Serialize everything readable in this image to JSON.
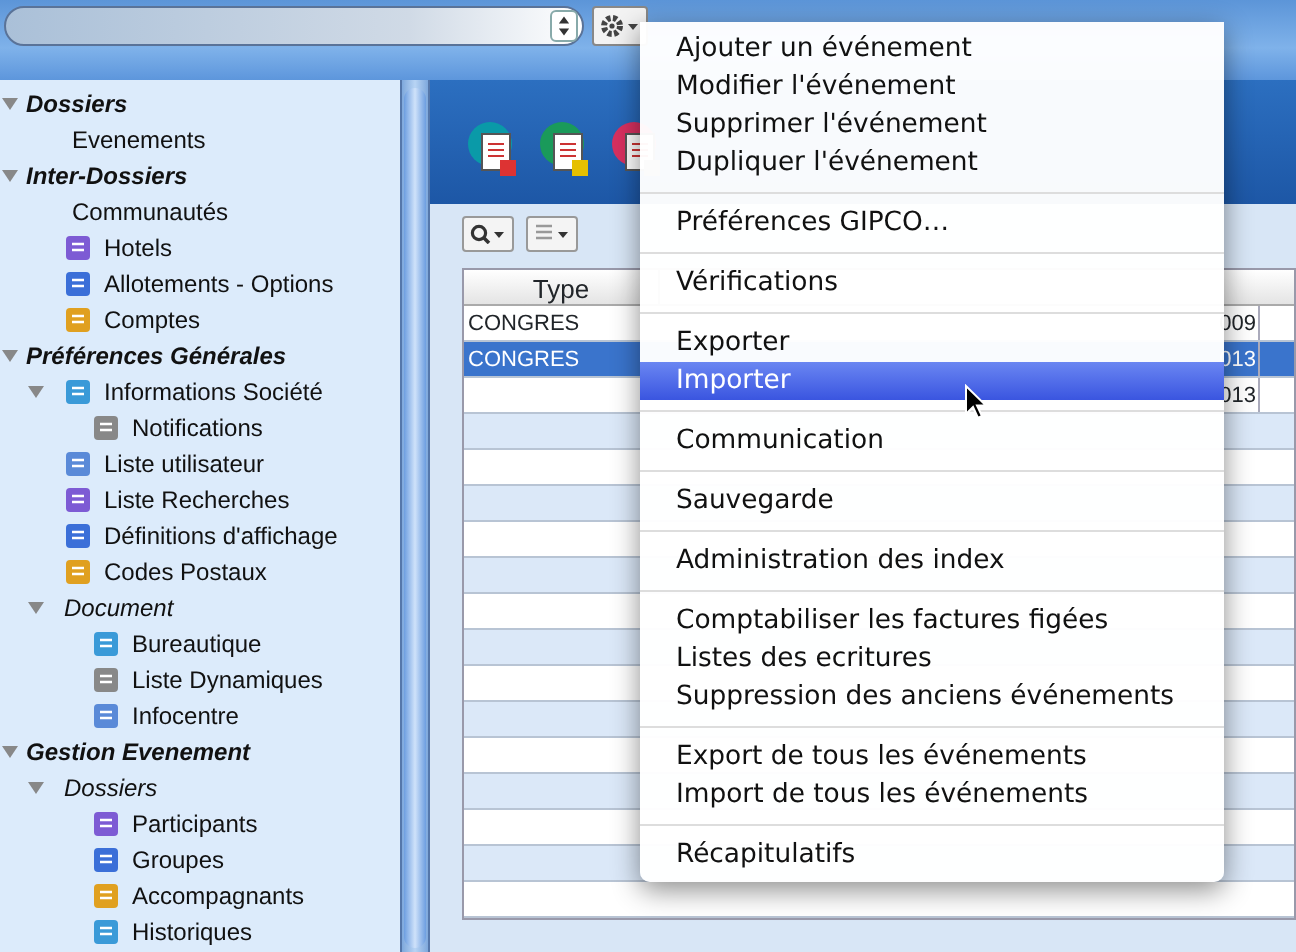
{
  "sidebar": {
    "items": [
      {
        "label": "Dossiers",
        "kind": "group",
        "expanded": true,
        "children": [
          {
            "label": "Evenements",
            "kind": "item"
          }
        ]
      },
      {
        "label": "Inter-Dossiers",
        "kind": "group",
        "expanded": true,
        "children": [
          {
            "label": "Communautés",
            "kind": "item"
          },
          {
            "label": "Hotels",
            "kind": "item",
            "icon": true
          },
          {
            "label": "Allotements - Options",
            "kind": "item",
            "icon": true
          },
          {
            "label": "Comptes",
            "kind": "item",
            "icon": true
          }
        ]
      },
      {
        "label": "Préférences Générales",
        "kind": "group",
        "expanded": true,
        "children": [
          {
            "label": "Informations Société",
            "kind": "item",
            "icon": true,
            "expanded": true,
            "children": [
              {
                "label": "Notifications",
                "kind": "item",
                "icon": true
              }
            ]
          },
          {
            "label": "Liste utilisateur",
            "kind": "item",
            "icon": true
          },
          {
            "label": "Liste Recherches",
            "kind": "item",
            "icon": true
          },
          {
            "label": "Définitions d'affichage",
            "kind": "item",
            "icon": true
          },
          {
            "label": "Codes Postaux",
            "kind": "item",
            "icon": true
          },
          {
            "label": "Document",
            "kind": "folder",
            "expanded": true,
            "children": [
              {
                "label": "Bureautique",
                "kind": "item",
                "icon": true
              },
              {
                "label": "Liste Dynamiques",
                "kind": "item",
                "icon": true
              },
              {
                "label": "Infocentre",
                "kind": "item",
                "icon": true
              }
            ]
          }
        ]
      },
      {
        "label": "Gestion Evenement",
        "kind": "group",
        "expanded": true,
        "children": [
          {
            "label": "Dossiers",
            "kind": "folder",
            "expanded": true,
            "children": [
              {
                "label": "Participants",
                "kind": "item",
                "icon": true
              },
              {
                "label": "Groupes",
                "kind": "item",
                "icon": true
              },
              {
                "label": "Accompagnants",
                "kind": "item",
                "icon": true
              },
              {
                "label": "Historiques",
                "kind": "item",
                "icon": true
              }
            ]
          }
        ]
      }
    ]
  },
  "table": {
    "columns": [
      "Type"
    ],
    "rows": [
      {
        "type": "CONGRES",
        "column_2": "009",
        "selected": false
      },
      {
        "type": "CONGRES",
        "column_2": "013",
        "selected": true
      },
      {
        "type": "",
        "column_2": "013",
        "selected": false
      }
    ]
  },
  "menu": {
    "sections": [
      [
        {
          "label": "Ajouter un événement",
          "selected": false
        },
        {
          "label": "Modifier l'événement",
          "selected": false
        },
        {
          "label": "Supprimer l'événement",
          "selected": false
        },
        {
          "label": "Dupliquer l'événement",
          "selected": false
        }
      ],
      [
        {
          "label": "Préférences GIPCO…",
          "selected": false
        }
      ],
      [
        {
          "label": "Vérifications",
          "selected": false
        }
      ],
      [
        {
          "label": "Exporter",
          "selected": false
        },
        {
          "label": "Importer",
          "selected": true
        }
      ],
      [
        {
          "label": "Communication",
          "selected": false
        }
      ],
      [
        {
          "label": "Sauvegarde",
          "selected": false
        }
      ],
      [
        {
          "label": "Administration des index",
          "selected": false
        }
      ],
      [
        {
          "label": "Comptabiliser les factures figées",
          "selected": false
        },
        {
          "label": "Listes des ecritures",
          "selected": false
        },
        {
          "label": "Suppression des anciens événements",
          "selected": false
        }
      ],
      [
        {
          "label": "Export de tous les événements",
          "selected": false
        },
        {
          "label": "Import de tous les événements",
          "selected": false
        }
      ],
      [
        {
          "label": "Récapitulatifs",
          "selected": false
        }
      ]
    ]
  }
}
